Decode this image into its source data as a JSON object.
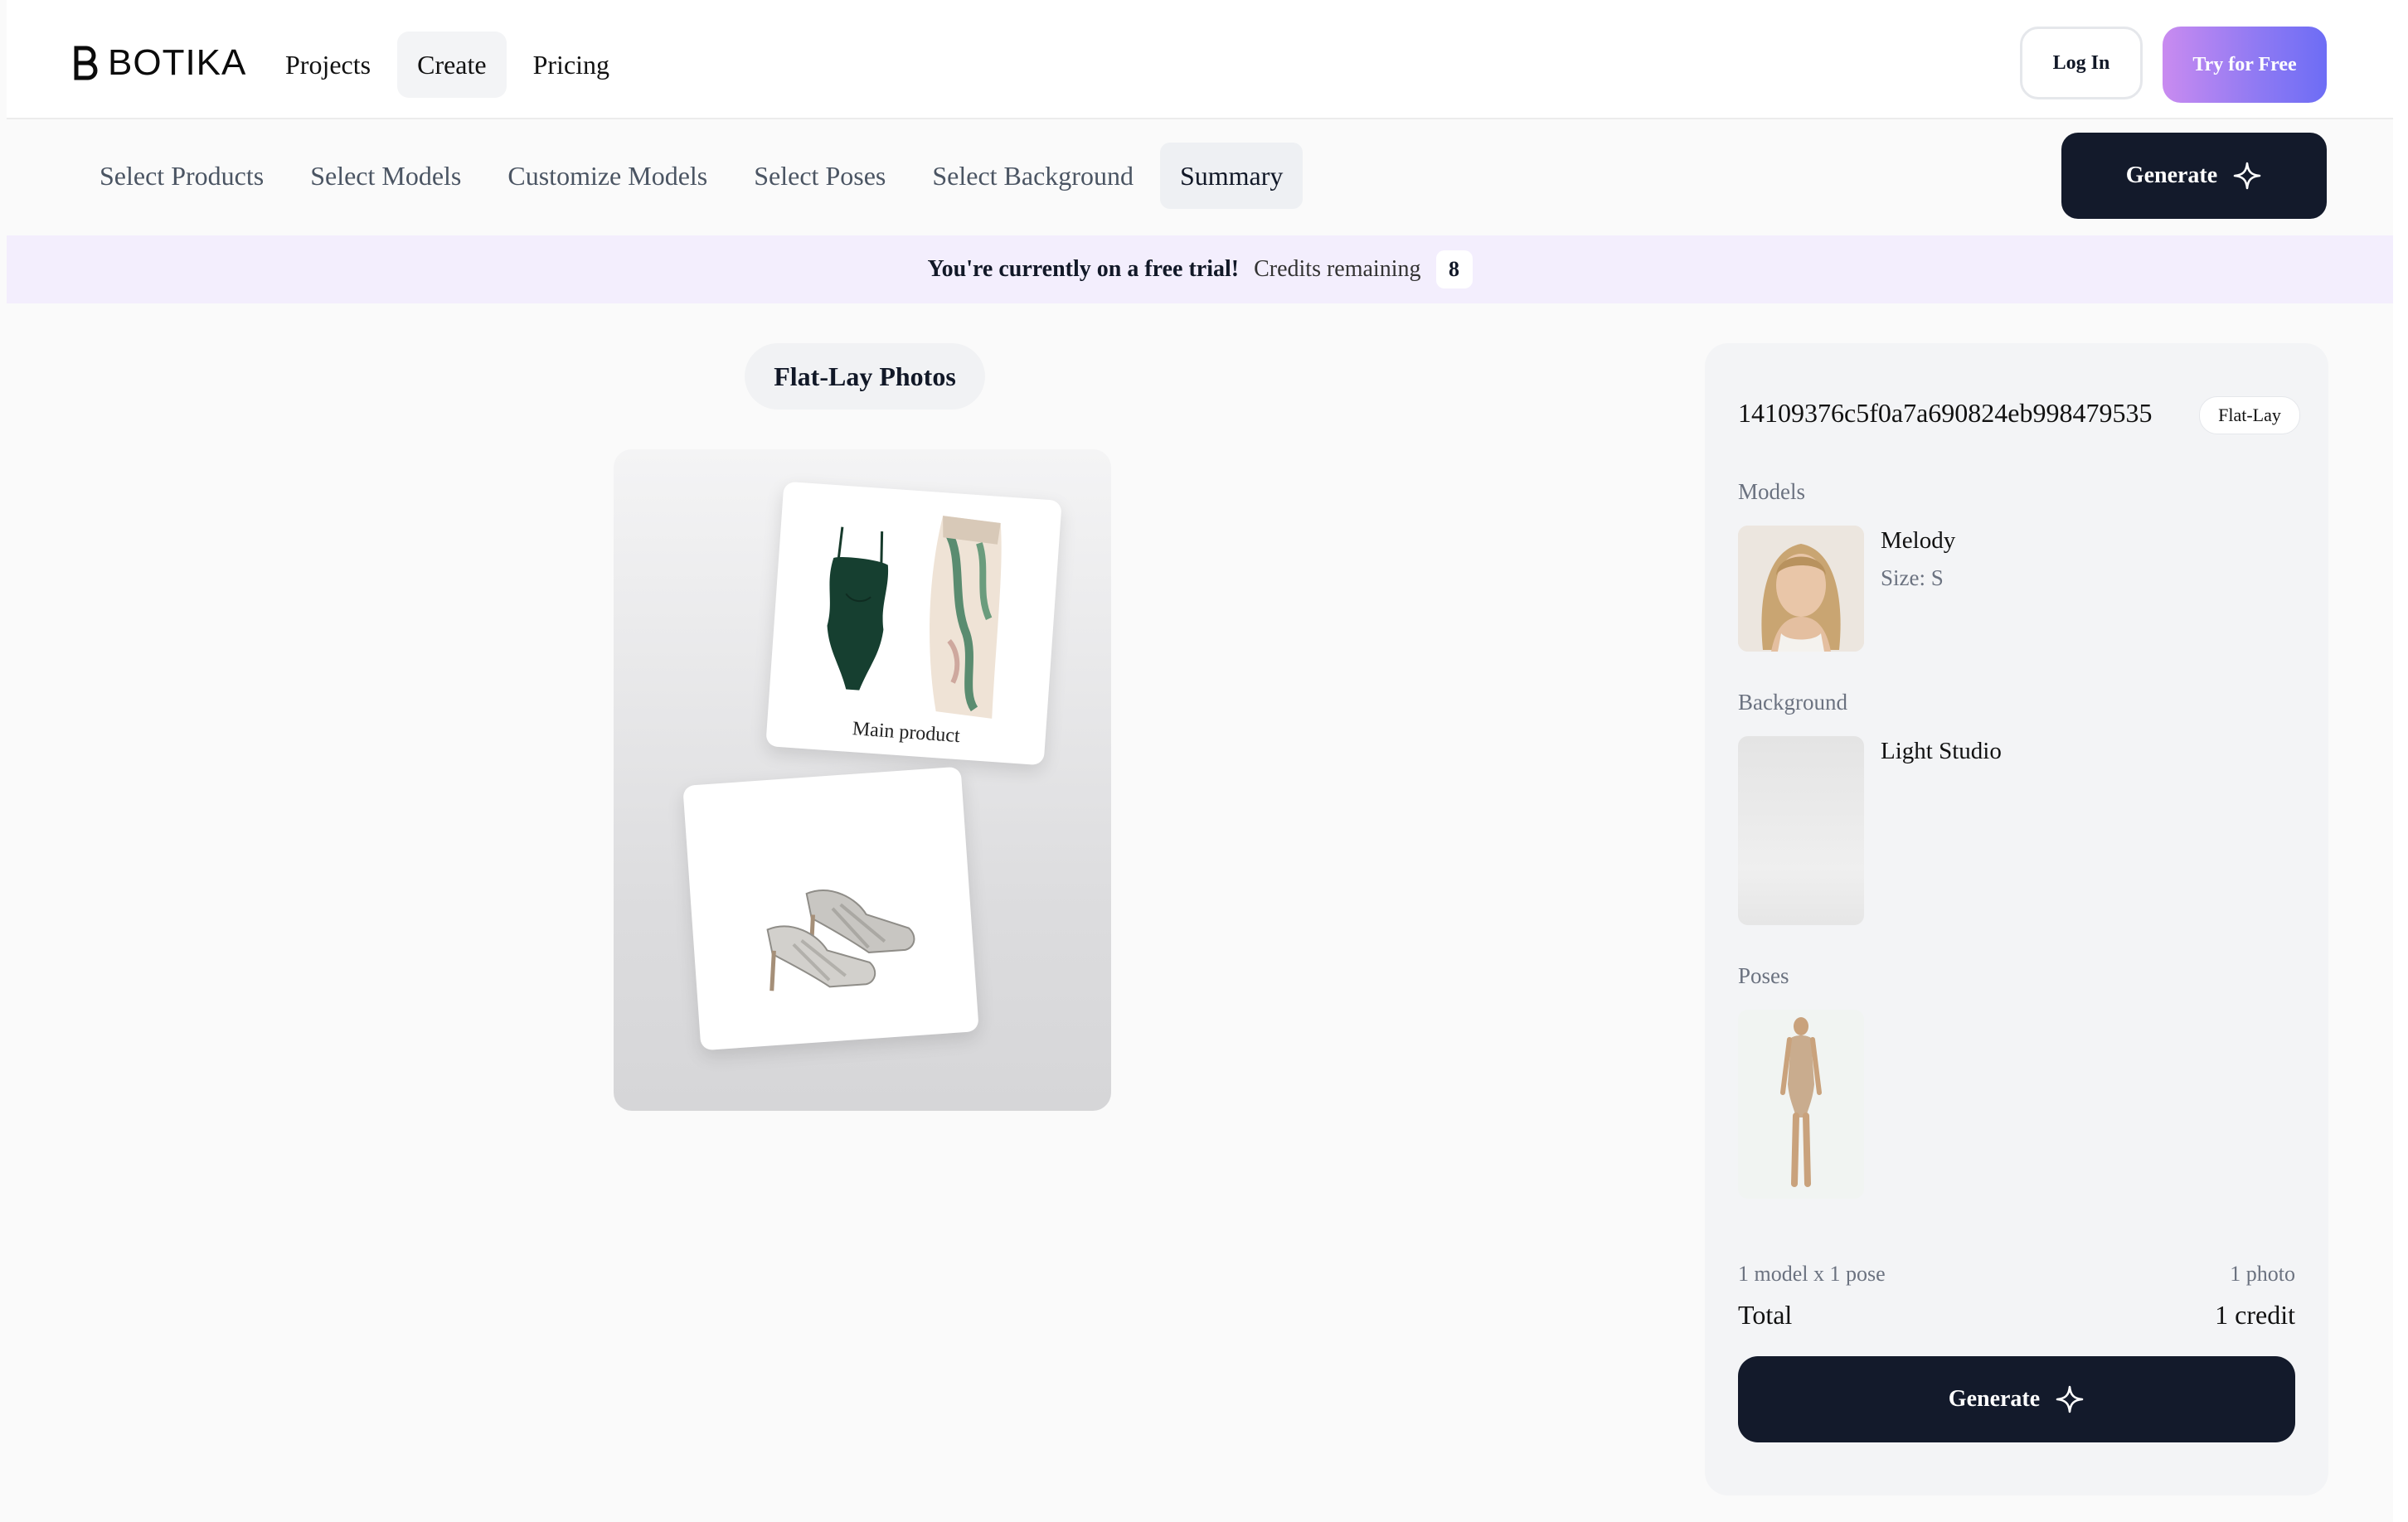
{
  "brand": {
    "name": "BOTIKA"
  },
  "nav": {
    "items": [
      {
        "label": "Projects",
        "active": false
      },
      {
        "label": "Create",
        "active": true
      },
      {
        "label": "Pricing",
        "active": false
      }
    ],
    "login_label": "Log In",
    "try_label": "Try for Free"
  },
  "steps": {
    "items": [
      {
        "label": "Select Products",
        "active": false
      },
      {
        "label": "Select Models",
        "active": false
      },
      {
        "label": "Customize Models",
        "active": false
      },
      {
        "label": "Select Poses",
        "active": false
      },
      {
        "label": "Select Background",
        "active": false
      },
      {
        "label": "Summary",
        "active": true
      }
    ],
    "generate_label": "Generate"
  },
  "banner": {
    "trial_text": "You're currently on a free trial!",
    "credits_label": "Credits remaining",
    "credits_count": "8"
  },
  "main": {
    "section_title": "Flat-Lay Photos",
    "main_product_label": "Main product"
  },
  "summary": {
    "project_id": "14109376c5f0a7a690824eb998479535",
    "type_tag": "Flat-Lay",
    "models_label": "Models",
    "model_name": "Melody",
    "model_size": "Size: S",
    "background_label": "Background",
    "background_name": "Light Studio",
    "poses_label": "Poses",
    "calc_text": "1 model x 1 pose",
    "calc_result": "1 photo",
    "total_label": "Total",
    "total_value": "1 credit",
    "generate_label": "Generate"
  },
  "colors": {
    "primary_dark": "#131a2b",
    "banner_bg": "#f3eefd",
    "try_gradient_start": "#c98bf0",
    "try_gradient_end": "#6d6df5"
  }
}
